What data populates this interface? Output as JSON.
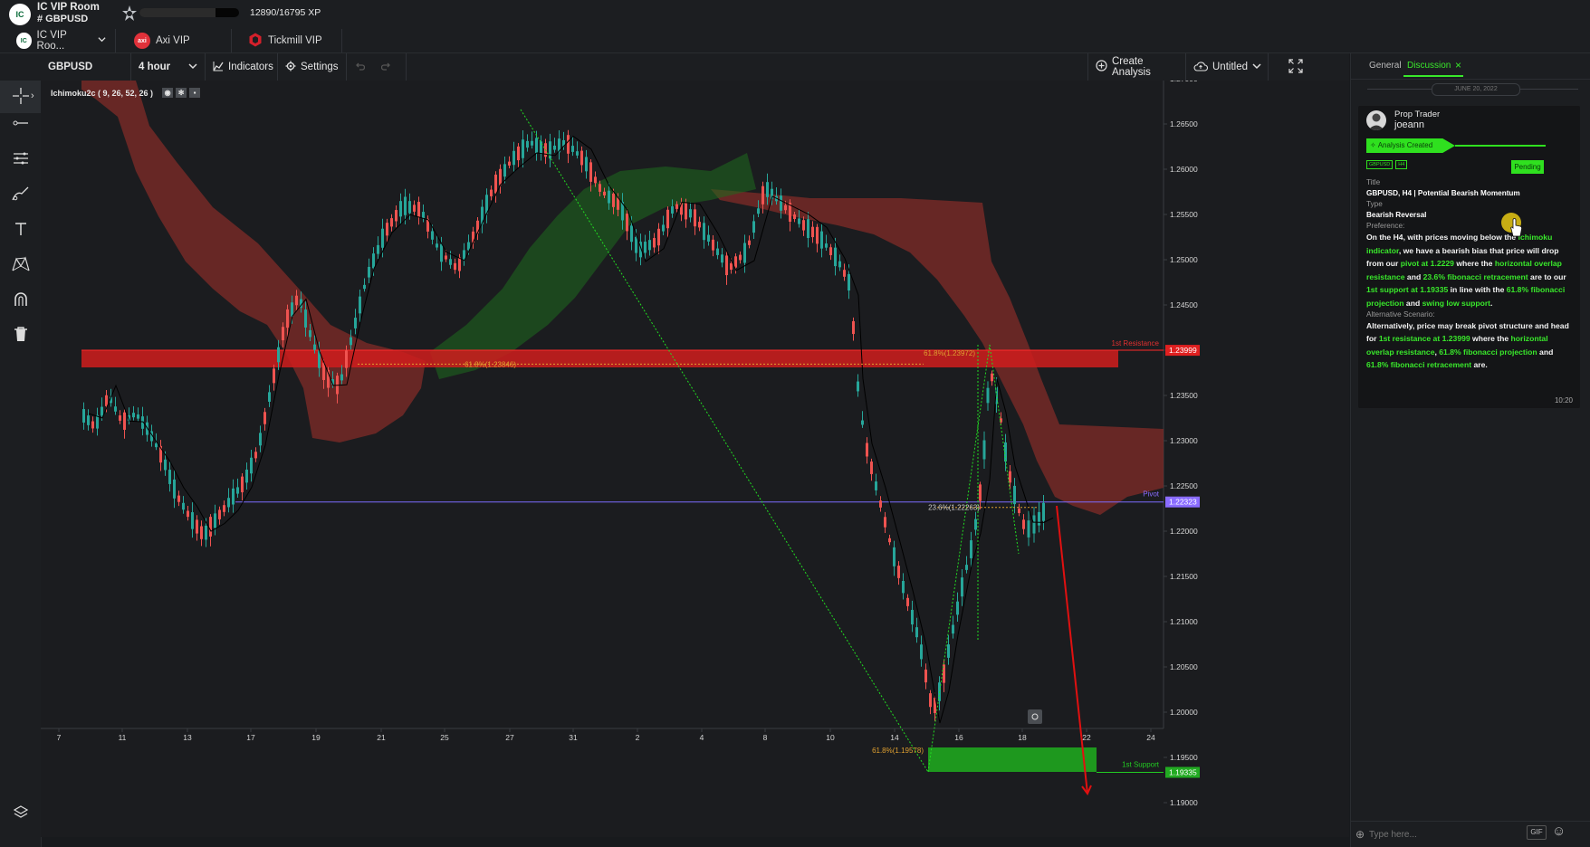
{
  "header": {
    "logo_text": "IC",
    "room_title": "IC VIP Room",
    "channel": "# GBPUSD",
    "xp": "12890/16795 XP",
    "xp_progress": 0.7675
  },
  "tabs": [
    {
      "label": "IC VIP Roo...",
      "icon": "ic-logo-icon"
    },
    {
      "label": "Axi VIP",
      "icon": "axi-logo-icon",
      "icon_text": "axi"
    },
    {
      "label": "Tickmill VIP",
      "icon": "tickmill-logo-icon"
    }
  ],
  "toolbar": {
    "symbol": "GBPUSD",
    "interval": "4 hour",
    "indicators": "Indicators",
    "settings": "Settings",
    "create_analysis": "Create Analysis",
    "layout_name": "Untitled"
  },
  "indicator": {
    "label": "Ichimoku2c ( 9, 26, 52, 26 )"
  },
  "chart_data": {
    "type": "candlestick",
    "symbol": "GBPUSD",
    "interval": "4 hour",
    "y_ticks": [
      "1.27000",
      "1.26500",
      "1.26000",
      "1.25500",
      "1.25000",
      "1.24500",
      "1.24000",
      "1.23500",
      "1.23000",
      "1.22500",
      "1.22000",
      "1.21500",
      "1.21000",
      "1.20500",
      "1.20000",
      "1.19500",
      "1.19000"
    ],
    "ylim": [
      1.19,
      1.27
    ],
    "x_ticks": [
      "7",
      "11",
      "13",
      "17",
      "19",
      "21",
      "25",
      "27",
      "31",
      "2",
      "4",
      "8",
      "10",
      "14",
      "16",
      "18",
      "22",
      "24"
    ],
    "levels": [
      {
        "label": "1st Resistance",
        "value": "1.23999",
        "color": "#e02020"
      },
      {
        "label": "Pivot",
        "value": "1.22323",
        "color": "#8a6cff"
      },
      {
        "label": "1st Support",
        "value": "1.19335",
        "color": "#22cc22"
      }
    ],
    "fib_labels": [
      {
        "text": "61.8%(1.23846)",
        "value": 1.23846
      },
      {
        "text": "61.8%(1.23972)",
        "value": 1.23972
      },
      {
        "text": "23.6%(1.22263)",
        "value": 1.22263
      },
      {
        "text": "61.8%(1.19578)",
        "value": 1.19578
      }
    ],
    "colors": {
      "up": "#26a69a",
      "down": "#ef5350",
      "cloud_bear": "#8b2e2a",
      "cloud_bull": "#1e6b1e"
    }
  },
  "panel": {
    "tab_general": "General",
    "tab_discussion": "Discussion",
    "close_glyph": "×",
    "date": "JUNE 20, 2022",
    "role": "Prop Trader",
    "username": "joeann",
    "status": "Analysis Created",
    "tags": [
      "GBPUSD",
      "H4"
    ],
    "pending": "Pending",
    "title_label": "Title",
    "title_value": "GBPUSD, H4 | Potential Bearish Momentum",
    "type_label": "Type",
    "type_value": "Bearish Reversal",
    "pref_label": "Preference:",
    "pref": {
      "s1": "On the H4, with prices moving below the ",
      "g1": "ichimoku indicator",
      "s2": ", we have a bearish bias that price will drop from our ",
      "g2": "pivot at 1.2229",
      "s3": " where the ",
      "g3": "horizontal overlap resistance",
      "s4": " and ",
      "g4": "23.6% fibonacci retracement",
      "s5": " are to our ",
      "g5": "1st support at 1.19335",
      "s6": " in line with the ",
      "g6": "61.8% fibonacci projection",
      "s7": " and ",
      "g7": "swing low support",
      "s8": "."
    },
    "alt_label": "Alternative Scenario:",
    "alt": {
      "s1": "Alternatively, price may break pivot structure and head for ",
      "g1": "1st resistance at 1.23999",
      "s2": " where the ",
      "g2": "horizontal overlap resistance",
      "s3": ", ",
      "g3": "61.8% fibonacci projection",
      "s4": " and ",
      "g4": "61.8% fibonacci retracement",
      "s5": " are."
    },
    "time": "10:20",
    "input_placeholder": "Type here...",
    "gif": "GIF"
  }
}
